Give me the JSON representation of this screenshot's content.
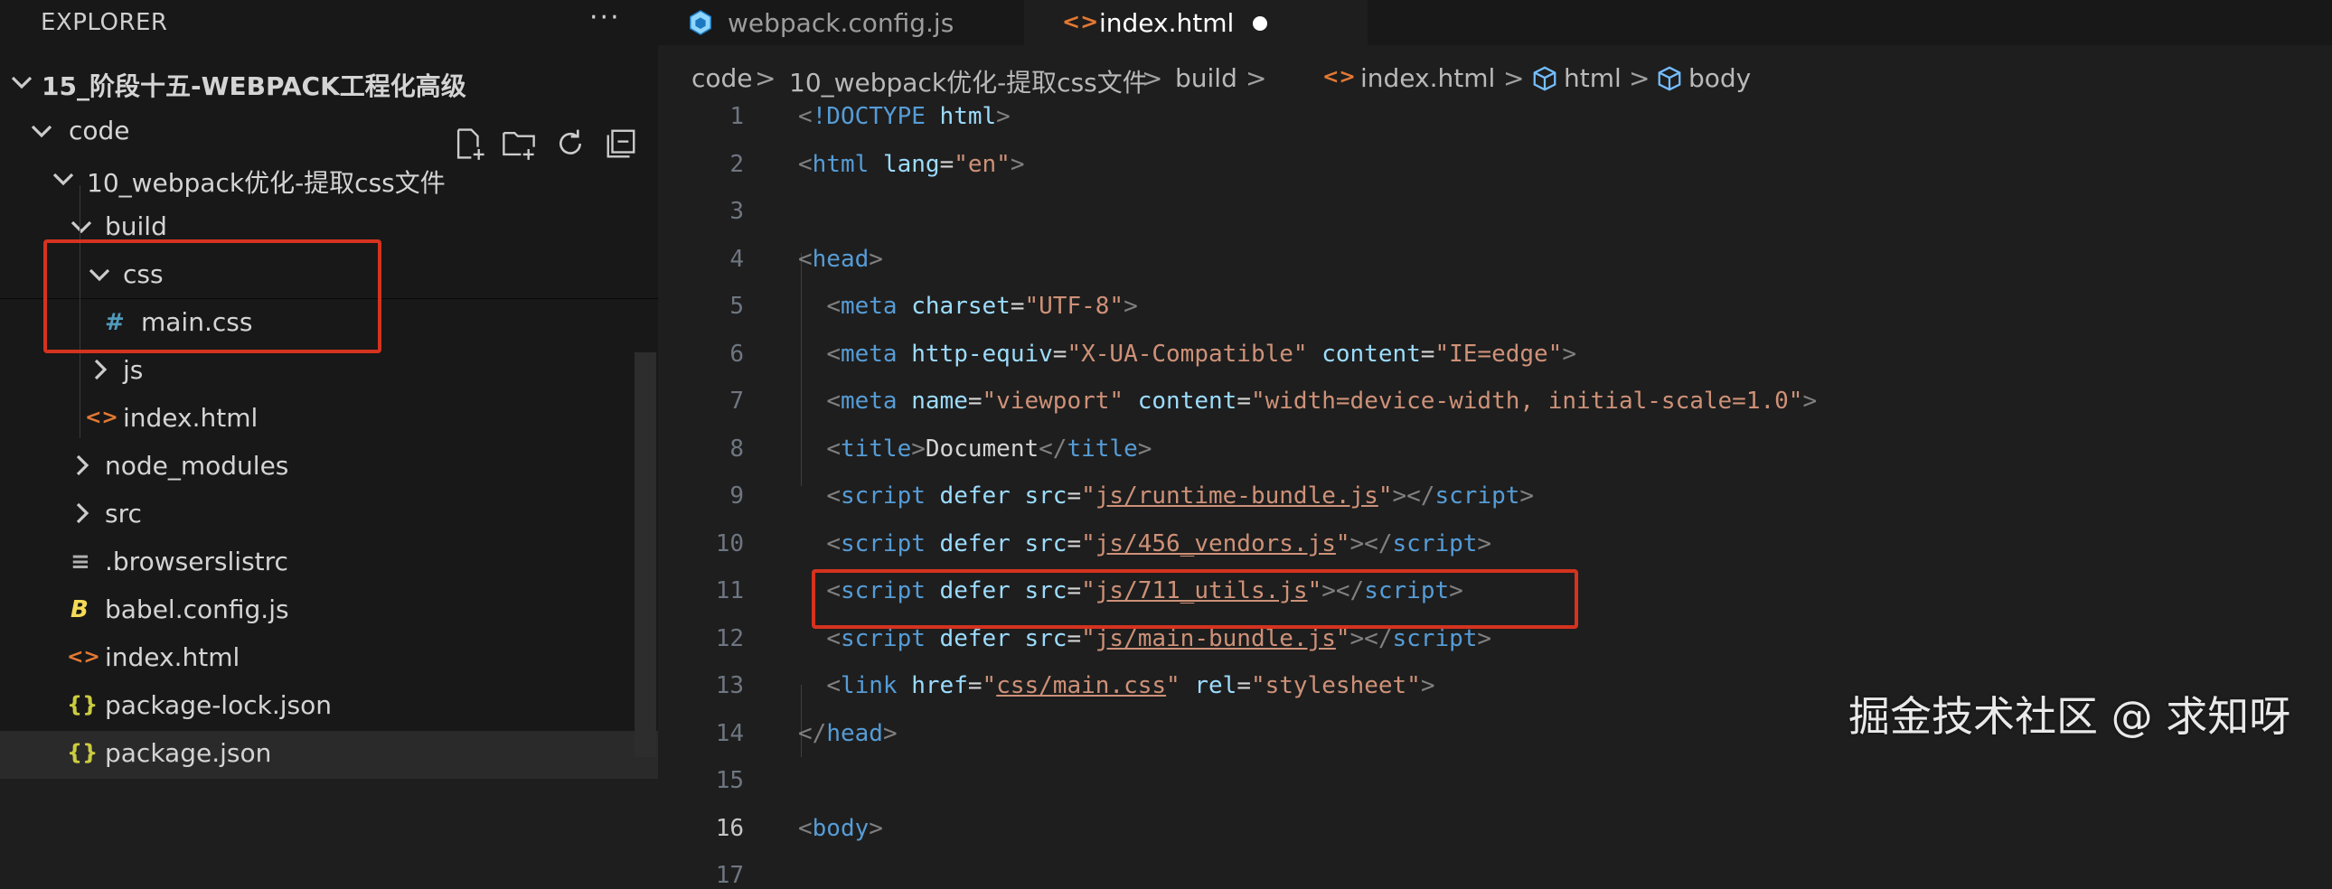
{
  "explorer": {
    "title": "EXPLORER",
    "more": "···",
    "root": "15_阶段十五-WEBPACK工程化高级",
    "items": [
      {
        "label": "code",
        "icon": "chevron-down-icon"
      },
      {
        "label": "10_webpack优化-提取css文件",
        "icon": "chevron-down-icon"
      },
      {
        "label": "build",
        "icon": "chevron-down-icon"
      },
      {
        "label": "css",
        "icon": "chevron-down-icon"
      },
      {
        "label": "main.css",
        "icon": "css-hash-icon",
        "glyph": "#"
      },
      {
        "label": "js",
        "icon": "chevron-right-icon"
      },
      {
        "label": "index.html",
        "icon": "html-icon",
        "glyph": "<>"
      },
      {
        "label": "node_modules",
        "icon": "chevron-right-icon"
      },
      {
        "label": "src",
        "icon": "chevron-right-icon"
      },
      {
        "label": ".browserslistrc",
        "icon": "lines-icon",
        "glyph": "≡"
      },
      {
        "label": "babel.config.js",
        "icon": "babel-icon",
        "glyph": "B"
      },
      {
        "label": "index.html",
        "icon": "html-icon",
        "glyph": "<>"
      },
      {
        "label": "package-lock.json",
        "icon": "json-icon",
        "glyph": "{}"
      },
      {
        "label": "package.json",
        "icon": "json-icon",
        "glyph": "{}"
      }
    ]
  },
  "tabs": [
    {
      "label": "webpack.config.js",
      "icon": "webpack-icon",
      "active": false
    },
    {
      "label": "index.html",
      "icon": "html-icon",
      "glyph": "<>",
      "active": true,
      "dirty": true
    }
  ],
  "breadcrumb": {
    "items": [
      "code",
      "10_webpack优化-提取css文件",
      "build",
      "index.html",
      "html",
      "body"
    ],
    "sep": ">",
    "html_glyph": "<>"
  },
  "code": {
    "current_line": "16",
    "lines": [
      {
        "num": "1",
        "segments": [
          [
            "punc",
            "<"
          ],
          [
            "tag",
            "!DOCTYPE"
          ],
          [
            "txt",
            " "
          ],
          [
            "attr",
            "html"
          ],
          [
            "punc",
            ">"
          ]
        ]
      },
      {
        "num": "2",
        "segments": [
          [
            "punc",
            "<"
          ],
          [
            "tag",
            "html"
          ],
          [
            "txt",
            " "
          ],
          [
            "attr",
            "lang"
          ],
          [
            "txt",
            "="
          ],
          [
            "str",
            "\"en\""
          ],
          [
            "punc",
            ">"
          ]
        ]
      },
      {
        "num": "3",
        "segments": []
      },
      {
        "num": "4",
        "segments": [
          [
            "punc",
            "<"
          ],
          [
            "tag",
            "head"
          ],
          [
            "punc",
            ">"
          ]
        ]
      },
      {
        "num": "5",
        "segments": [
          [
            "txt",
            "  "
          ],
          [
            "punc",
            "<"
          ],
          [
            "tag",
            "meta"
          ],
          [
            "txt",
            " "
          ],
          [
            "attr",
            "charset"
          ],
          [
            "txt",
            "="
          ],
          [
            "str",
            "\"UTF-8\""
          ],
          [
            "punc",
            ">"
          ]
        ]
      },
      {
        "num": "6",
        "segments": [
          [
            "txt",
            "  "
          ],
          [
            "punc",
            "<"
          ],
          [
            "tag",
            "meta"
          ],
          [
            "txt",
            " "
          ],
          [
            "attr",
            "http-equiv"
          ],
          [
            "txt",
            "="
          ],
          [
            "str",
            "\"X-UA-Compatible\""
          ],
          [
            "txt",
            " "
          ],
          [
            "attr",
            "content"
          ],
          [
            "txt",
            "="
          ],
          [
            "str",
            "\"IE=edge\""
          ],
          [
            "punc",
            ">"
          ]
        ]
      },
      {
        "num": "7",
        "segments": [
          [
            "txt",
            "  "
          ],
          [
            "punc",
            "<"
          ],
          [
            "tag",
            "meta"
          ],
          [
            "txt",
            " "
          ],
          [
            "attr",
            "name"
          ],
          [
            "txt",
            "="
          ],
          [
            "str",
            "\"viewport\""
          ],
          [
            "txt",
            " "
          ],
          [
            "attr",
            "content"
          ],
          [
            "txt",
            "="
          ],
          [
            "str",
            "\"width=device-width, initial-scale=1.0\""
          ],
          [
            "punc",
            ">"
          ]
        ]
      },
      {
        "num": "8",
        "segments": [
          [
            "txt",
            "  "
          ],
          [
            "punc",
            "<"
          ],
          [
            "tag",
            "title"
          ],
          [
            "punc",
            ">"
          ],
          [
            "txt",
            "Document"
          ],
          [
            "punc",
            "</"
          ],
          [
            "tag",
            "title"
          ],
          [
            "punc",
            ">"
          ]
        ]
      },
      {
        "num": "9",
        "segments": [
          [
            "txt",
            "  "
          ],
          [
            "punc",
            "<"
          ],
          [
            "tag",
            "script"
          ],
          [
            "txt",
            " "
          ],
          [
            "attr",
            "defer"
          ],
          [
            "txt",
            " "
          ],
          [
            "attr",
            "src"
          ],
          [
            "txt",
            "="
          ],
          [
            "str",
            "\""
          ],
          [
            "str ul",
            "js/runtime-bundle.js"
          ],
          [
            "str",
            "\""
          ],
          [
            "punc",
            "></"
          ],
          [
            "tag",
            "script"
          ],
          [
            "punc",
            ">"
          ]
        ]
      },
      {
        "num": "10",
        "segments": [
          [
            "txt",
            "  "
          ],
          [
            "punc",
            "<"
          ],
          [
            "tag",
            "script"
          ],
          [
            "txt",
            " "
          ],
          [
            "attr",
            "defer"
          ],
          [
            "txt",
            " "
          ],
          [
            "attr",
            "src"
          ],
          [
            "txt",
            "="
          ],
          [
            "str",
            "\""
          ],
          [
            "str ul",
            "js/456_vendors.js"
          ],
          [
            "str",
            "\""
          ],
          [
            "punc",
            "></"
          ],
          [
            "tag",
            "script"
          ],
          [
            "punc",
            ">"
          ]
        ]
      },
      {
        "num": "11",
        "segments": [
          [
            "txt",
            "  "
          ],
          [
            "punc",
            "<"
          ],
          [
            "tag",
            "script"
          ],
          [
            "txt",
            " "
          ],
          [
            "attr",
            "defer"
          ],
          [
            "txt",
            " "
          ],
          [
            "attr",
            "src"
          ],
          [
            "txt",
            "="
          ],
          [
            "str",
            "\""
          ],
          [
            "str ul",
            "js/711_utils.js"
          ],
          [
            "str",
            "\""
          ],
          [
            "punc",
            "></"
          ],
          [
            "tag",
            "script"
          ],
          [
            "punc",
            ">"
          ]
        ]
      },
      {
        "num": "12",
        "segments": [
          [
            "txt",
            "  "
          ],
          [
            "punc",
            "<"
          ],
          [
            "tag",
            "script"
          ],
          [
            "txt",
            " "
          ],
          [
            "attr",
            "defer"
          ],
          [
            "txt",
            " "
          ],
          [
            "attr",
            "src"
          ],
          [
            "txt",
            "="
          ],
          [
            "str",
            "\""
          ],
          [
            "str ul",
            "js/main-bundle.js"
          ],
          [
            "str",
            "\""
          ],
          [
            "punc",
            "></"
          ],
          [
            "tag",
            "script"
          ],
          [
            "punc",
            ">"
          ]
        ]
      },
      {
        "num": "13",
        "segments": [
          [
            "txt",
            "  "
          ],
          [
            "punc",
            "<"
          ],
          [
            "tag",
            "link"
          ],
          [
            "txt",
            " "
          ],
          [
            "attr",
            "href"
          ],
          [
            "txt",
            "="
          ],
          [
            "str",
            "\""
          ],
          [
            "str ul",
            "css/main.css"
          ],
          [
            "str",
            "\""
          ],
          [
            "txt",
            " "
          ],
          [
            "attr",
            "rel"
          ],
          [
            "txt",
            "="
          ],
          [
            "str",
            "\"stylesheet\""
          ],
          [
            "punc",
            ">"
          ]
        ]
      },
      {
        "num": "14",
        "segments": [
          [
            "punc",
            "</"
          ],
          [
            "tag",
            "head"
          ],
          [
            "punc",
            ">"
          ]
        ]
      },
      {
        "num": "15",
        "segments": []
      },
      {
        "num": "16",
        "segments": [
          [
            "punc",
            "<"
          ],
          [
            "tag",
            "body"
          ],
          [
            "punc",
            ">"
          ]
        ]
      },
      {
        "num": "17",
        "segments": []
      }
    ]
  },
  "watermark": "掘金技术社区 @ 求知呀",
  "colors": {
    "highlight": "#d5331f",
    "tag": "#569cd6",
    "attr": "#9cdcfe",
    "string": "#ce9178"
  }
}
